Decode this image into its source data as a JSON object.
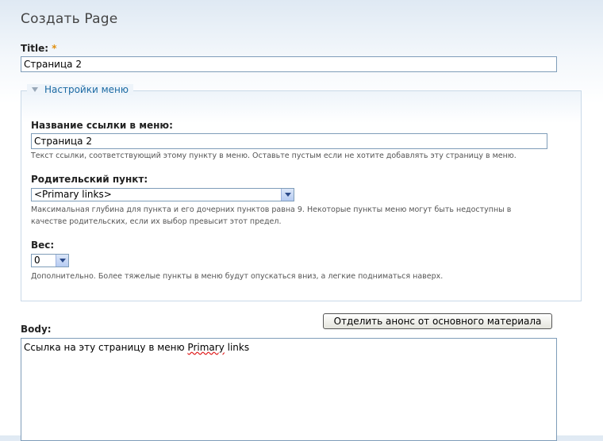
{
  "page": {
    "title": "Создать Page"
  },
  "title_field": {
    "label": "Title:",
    "required_mark": "*",
    "value": "Страница 2"
  },
  "menu_settings": {
    "legend": "Настройки меню",
    "link_title": {
      "label": "Название ссылки в меню:",
      "value": "Страница 2",
      "description": "Текст ссылки, соответствующий этому пункту в меню. Оставьте пустым если не хотите добавлять эту страницу в меню."
    },
    "parent": {
      "label": "Родительский пункт:",
      "selected": "<Primary links>",
      "description_line1": "Максимальная глубина для пункта и его дочерних пунктов равна 9. Некоторые пункты меню могут быть недоступны в",
      "description_line2": "качестве родительских, если их выбор превысит этот предел."
    },
    "weight": {
      "label": "Вес:",
      "selected": "0",
      "description": "Дополнительно. Более тяжелые пункты в меню будут опускаться вниз, а легкие подниматься наверх."
    }
  },
  "body_field": {
    "label": "Body:",
    "split_button": "Отделить анонс от основного материала",
    "text_before": "Ссылка на эту страницу в меню ",
    "text_misspelled": "Primary",
    "text_after": " links"
  }
}
